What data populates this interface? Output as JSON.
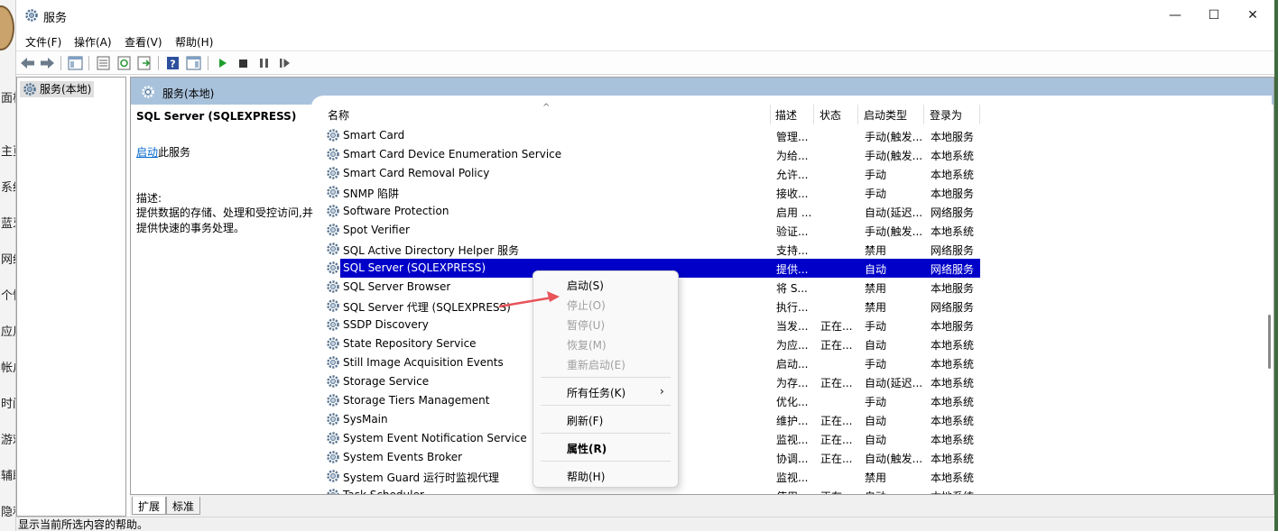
{
  "window": {
    "title": "服务",
    "controls": {
      "minimize": "—",
      "maximize": "☐",
      "close": "✕"
    }
  },
  "background_sidebar": [
    "面板",
    "主页",
    "系统",
    "蓝牙",
    "网络",
    "个性",
    "应用",
    "帐户",
    "时间",
    "游戏",
    "辅助",
    "隐私"
  ],
  "menu": [
    "文件(F)",
    "操作(A)",
    "查看(V)",
    "帮助(H)"
  ],
  "toolbar": {
    "icons": [
      "back-icon",
      "forward-icon",
      "show-hide-tree-icon",
      "properties-icon",
      "refresh-icon",
      "export-list-icon",
      "help-icon",
      "show-action-pane-icon",
      "play-icon",
      "stop-icon",
      "pause-icon",
      "resume-icon"
    ]
  },
  "tree": {
    "root_label": "服务(本地)"
  },
  "main": {
    "header_title": "服务(本地)",
    "selected_service": {
      "name": "SQL Server (SQLEXPRESS)",
      "start_link": "启动",
      "start_suffix": "此服务",
      "desc_label": "描述:",
      "desc_text": "提供数据的存储、处理和受控访问,并提供快速的事务处理。"
    },
    "columns": [
      "名称",
      "描述",
      "状态",
      "启动类型",
      "登录为"
    ],
    "rows": [
      {
        "name": "Smart Card",
        "desc": "管理...",
        "status": "",
        "start": "手动(触发...",
        "logon": "本地服务"
      },
      {
        "name": "Smart Card Device Enumeration Service",
        "desc": "为给...",
        "status": "",
        "start": "手动(触发...",
        "logon": "本地系统"
      },
      {
        "name": "Smart Card Removal Policy",
        "desc": "允许...",
        "status": "",
        "start": "手动",
        "logon": "本地系统"
      },
      {
        "name": "SNMP 陷阱",
        "desc": "接收...",
        "status": "",
        "start": "手动",
        "logon": "本地服务"
      },
      {
        "name": "Software Protection",
        "desc": "启用 ...",
        "status": "",
        "start": "自动(延迟...",
        "logon": "网络服务"
      },
      {
        "name": "Spot Verifier",
        "desc": "验证...",
        "status": "",
        "start": "手动(触发...",
        "logon": "本地系统"
      },
      {
        "name": "SQL Active Directory Helper 服务",
        "desc": "支持...",
        "status": "",
        "start": "禁用",
        "logon": "网络服务"
      },
      {
        "name": "SQL Server (SQLEXPRESS)",
        "desc": "提供...",
        "status": "",
        "start": "自动",
        "logon": "网络服务",
        "selected": true
      },
      {
        "name": "SQL Server Browser",
        "desc": "将 S...",
        "status": "",
        "start": "禁用",
        "logon": "本地服务"
      },
      {
        "name": "SQL Server 代理 (SQLEXPRESS)",
        "desc": "执行...",
        "status": "",
        "start": "禁用",
        "logon": "网络服务"
      },
      {
        "name": "SSDP Discovery",
        "desc": "当发...",
        "status": "正在...",
        "start": "手动",
        "logon": "本地服务"
      },
      {
        "name": "State Repository Service",
        "desc": "为应...",
        "status": "正在...",
        "start": "自动",
        "logon": "本地系统"
      },
      {
        "name": "Still Image Acquisition Events",
        "desc": "启动...",
        "status": "",
        "start": "手动",
        "logon": "本地系统"
      },
      {
        "name": "Storage Service",
        "desc": "为存...",
        "status": "正在...",
        "start": "自动(延迟...",
        "logon": "本地系统"
      },
      {
        "name": "Storage Tiers Management",
        "desc": "优化...",
        "status": "",
        "start": "手动",
        "logon": "本地系统"
      },
      {
        "name": "SysMain",
        "desc": "维护...",
        "status": "正在...",
        "start": "自动",
        "logon": "本地系统"
      },
      {
        "name": "System Event Notification Service",
        "desc": "监视...",
        "status": "正在...",
        "start": "自动",
        "logon": "本地系统"
      },
      {
        "name": "System Events Broker",
        "desc": "协调...",
        "status": "正在...",
        "start": "自动(触发...",
        "logon": "本地系统"
      },
      {
        "name": "System Guard 运行时监视代理",
        "desc": "监视...",
        "status": "",
        "start": "禁用",
        "logon": "本地系统"
      },
      {
        "name": "Task Scheduler",
        "desc": "使用...",
        "status": "正在...",
        "start": "自动",
        "logon": "本地系统"
      }
    ]
  },
  "context_menu": {
    "items": [
      {
        "label": "启动(S)",
        "disabled": false
      },
      {
        "label": "停止(O)",
        "disabled": true
      },
      {
        "label": "暂停(U)",
        "disabled": true
      },
      {
        "label": "恢复(M)",
        "disabled": true
      },
      {
        "label": "重新启动(E)",
        "disabled": true
      },
      {
        "label": "所有任务(K)",
        "disabled": false,
        "submenu": true
      },
      {
        "label": "刷新(F)",
        "disabled": false
      },
      {
        "label": "属性(R)",
        "disabled": false,
        "bold": true
      },
      {
        "label": "帮助(H)",
        "disabled": false
      }
    ],
    "submenu_arrow": "›"
  },
  "tabs": [
    "扩展",
    "标准"
  ],
  "status_bar": "显示当前所选内容的帮助。",
  "colors": {
    "selection": "#0000c8",
    "header": "#a9c2dc",
    "link": "#0066cc",
    "arrow": "#e8545a"
  }
}
